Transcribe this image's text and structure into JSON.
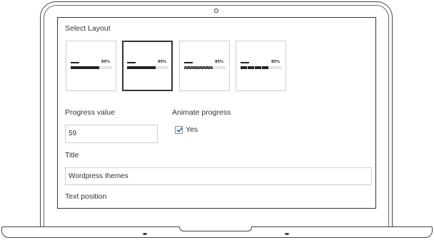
{
  "form": {
    "select_layout_label": "Select Layout",
    "layouts": [
      {
        "name": "plain",
        "percent_label": "85%",
        "selected": false
      },
      {
        "name": "plain-selected",
        "percent_label": "85%",
        "selected": true
      },
      {
        "name": "striped",
        "percent_label": "85%",
        "selected": false
      },
      {
        "name": "segmented",
        "percent_label": "85%",
        "selected": false
      }
    ],
    "progress_value_label": "Progress value",
    "progress_value": "59",
    "animate_progress_label": "Animate progress",
    "animate_checked": true,
    "animate_option_label": "Yes",
    "title_label": "Title",
    "title_value": "Wordpress themes",
    "text_position_label": "Text position"
  },
  "icons": {
    "checkbox_check": "check-icon",
    "camera": "camera-icon"
  },
  "colors": {
    "frame": "#444444",
    "bar_fill": "#222222",
    "bar_track": "#e4e4e4",
    "check": "#2a6ebb"
  }
}
